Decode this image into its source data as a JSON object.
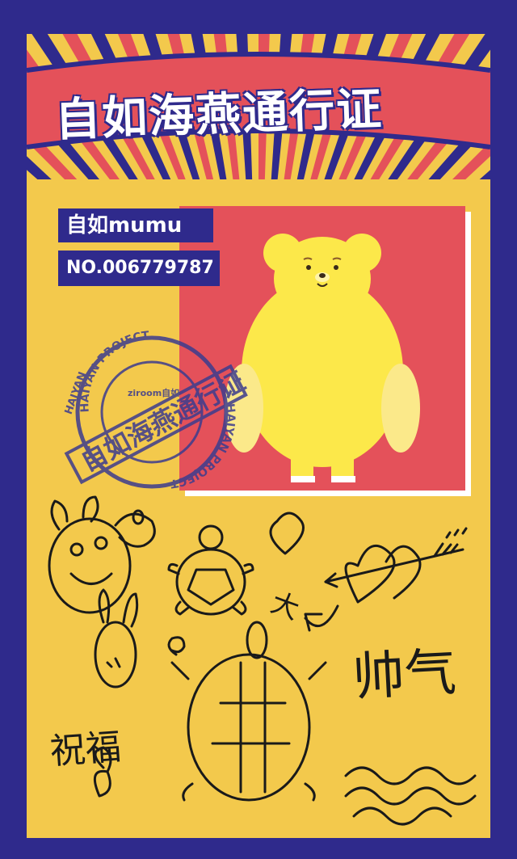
{
  "header": {
    "title": "自如海燕通行证"
  },
  "badge": {
    "name": "自如mumu",
    "number": "NO.006779787"
  },
  "stamp": {
    "ring_top": "HAIYAN PROJECT",
    "ring_right": "HAIYAN PROJECT",
    "ring_left": "HAIYAN",
    "center_logo": "ziroom自如",
    "banner": "自如海燕通行证"
  },
  "doodles": {
    "text_blessing": "祝福",
    "text_handsome": "帅气",
    "text_big": "大"
  },
  "colors": {
    "navy": "#2f2a8c",
    "yellow": "#f3c94c",
    "red": "#e4515a",
    "bear": "#fce84a"
  }
}
